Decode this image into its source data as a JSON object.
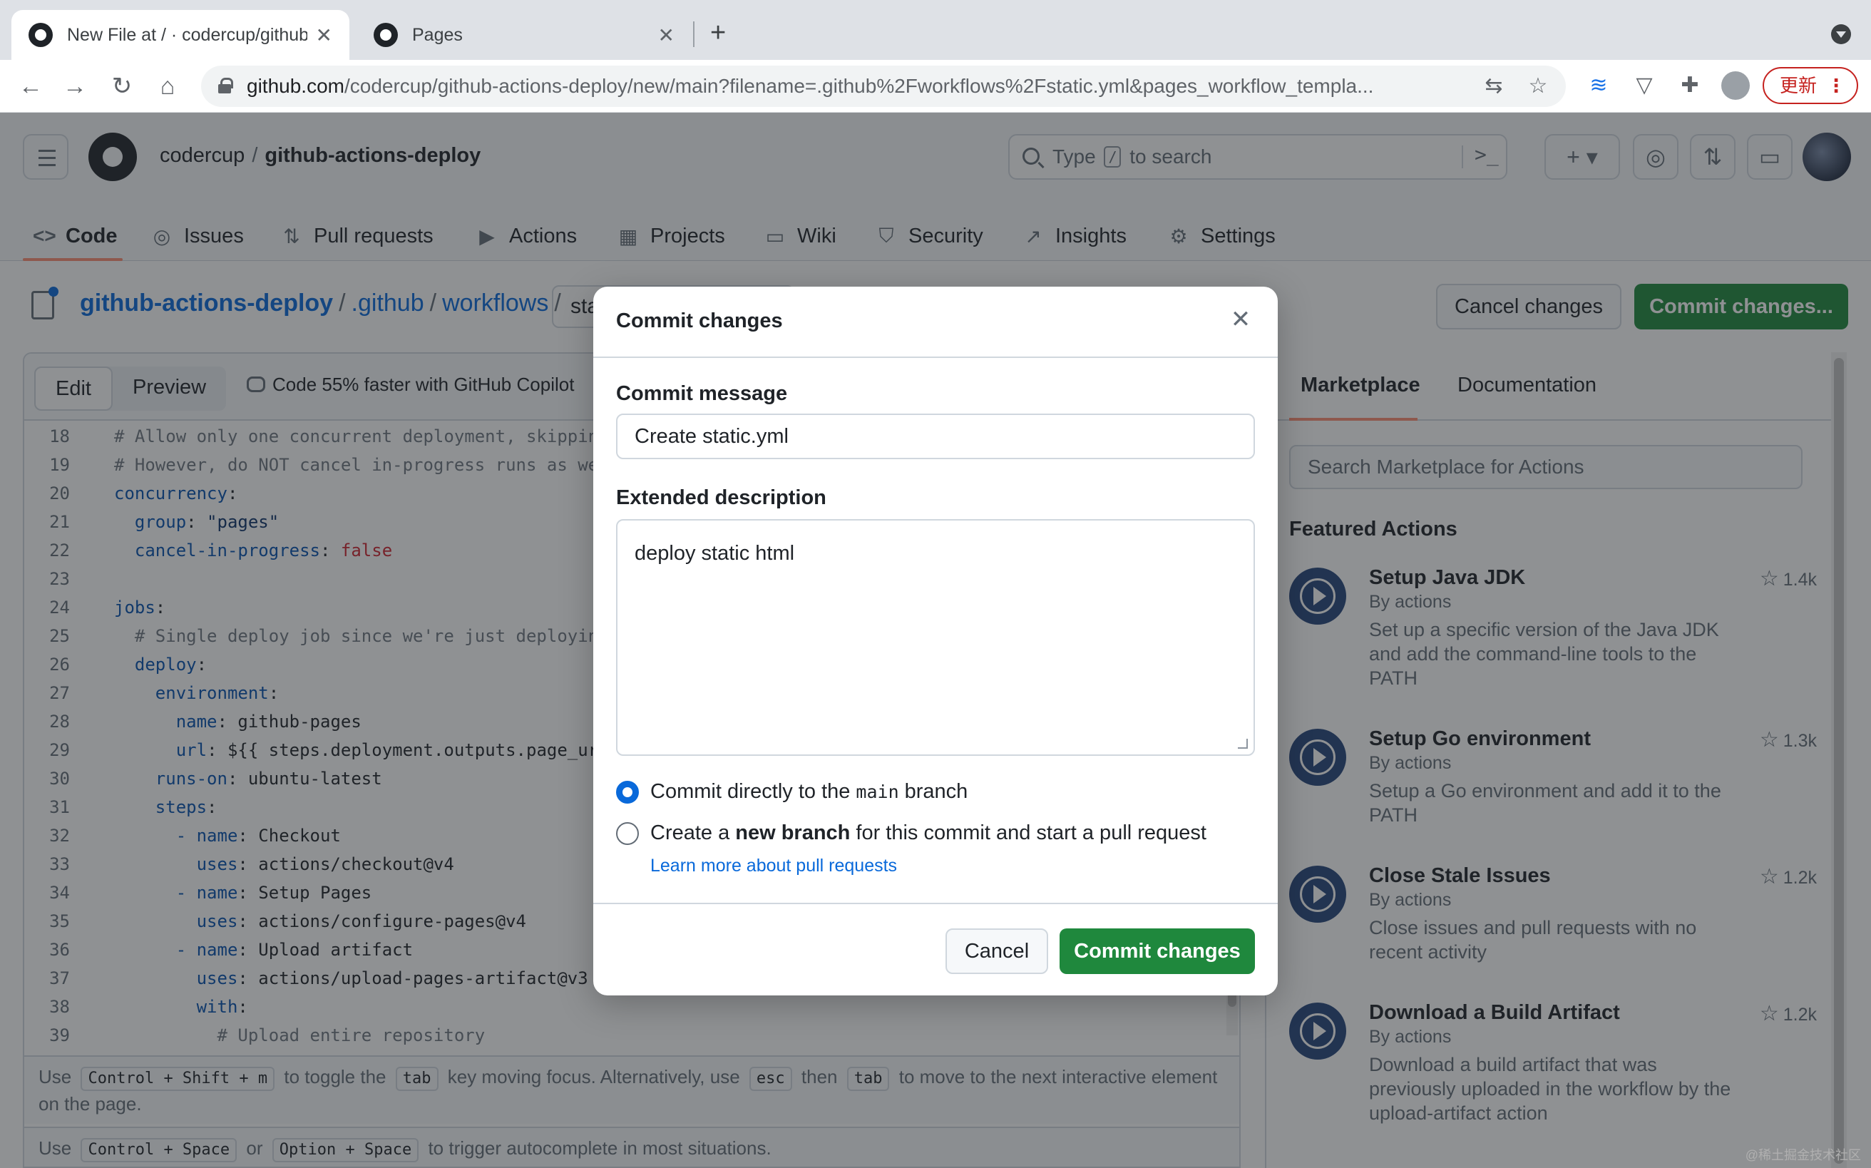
{
  "browser": {
    "tabs": [
      {
        "title": "New File at / · codercup/github-actions-deploy",
        "close": "✕"
      },
      {
        "title": "Pages",
        "close": "✕"
      }
    ],
    "new_tab": "+",
    "url_host": "github.com",
    "url_path": "/codercup/github-actions-deploy/new/main?filename=.github%2Fworkflows%2Fstatic.yml&pages_workflow_templa...",
    "update_label": "更新",
    "update_dots": "⋮"
  },
  "header": {
    "owner": "codercup",
    "separator": "/",
    "repo": "github-actions-deploy",
    "search_prefix": "Type",
    "search_key": "/",
    "search_suffix": "to search",
    "nav": [
      {
        "label": "Code",
        "icon": "<>"
      },
      {
        "label": "Issues",
        "icon": "◎"
      },
      {
        "label": "Pull requests",
        "icon": "⇅"
      },
      {
        "label": "Actions",
        "icon": "▶"
      },
      {
        "label": "Projects",
        "icon": "▦"
      },
      {
        "label": "Wiki",
        "icon": "▭"
      },
      {
        "label": "Security",
        "icon": "⛉"
      },
      {
        "label": "Insights",
        "icon": "↗"
      },
      {
        "label": "Settings",
        "icon": "⚙"
      }
    ]
  },
  "editor_page": {
    "crumbs": [
      "github-actions-deploy",
      "/",
      ".github",
      "/",
      "workflows",
      "/"
    ],
    "filename": "static.yml",
    "cancel_changes": "Cancel changes",
    "commit_changes": "Commit changes...",
    "tab_edit": "Edit",
    "tab_preview": "Preview",
    "copilot": "Code 55% faster with GitHub Copilot",
    "code_lines": [
      {
        "n": "18",
        "text": "# Allow only one concurrent deployment, skippin"
      },
      {
        "n": "19",
        "text": "# However, do NOT cancel in-progress runs as we"
      },
      {
        "n": "20",
        "text": "concurrency:"
      },
      {
        "n": "21",
        "text": "  group: \"pages\""
      },
      {
        "n": "22",
        "text": "  cancel-in-progress: false"
      },
      {
        "n": "23",
        "text": ""
      },
      {
        "n": "24",
        "text": "jobs:"
      },
      {
        "n": "25",
        "text": "  # Single deploy job since we're just deployin"
      },
      {
        "n": "26",
        "text": "  deploy:"
      },
      {
        "n": "27",
        "text": "    environment:"
      },
      {
        "n": "28",
        "text": "      name: github-pages"
      },
      {
        "n": "29",
        "text": "      url: ${{ steps.deployment.outputs.page_ur"
      },
      {
        "n": "30",
        "text": "    runs-on: ubuntu-latest"
      },
      {
        "n": "31",
        "text": "    steps:"
      },
      {
        "n": "32",
        "text": "      - name: Checkout"
      },
      {
        "n": "33",
        "text": "        uses: actions/checkout@v4"
      },
      {
        "n": "34",
        "text": "      - name: Setup Pages"
      },
      {
        "n": "35",
        "text": "        uses: actions/configure-pages@v4"
      },
      {
        "n": "36",
        "text": "      - name: Upload artifact"
      },
      {
        "n": "37",
        "text": "        uses: actions/upload-pages-artifact@v3"
      },
      {
        "n": "38",
        "text": "        with:"
      },
      {
        "n": "39",
        "text": "          # Upload entire repository"
      }
    ],
    "hint1": {
      "use": "Use",
      "k1": "Control + Shift + m",
      "t1": "to toggle the",
      "k2": "tab",
      "t2": "key moving focus. Alternatively, use",
      "k3": "esc",
      "t3": "then",
      "k4": "tab",
      "t4": "to move to the next interactive element on the page."
    },
    "hint2": {
      "use": "Use",
      "k1": "Control + Space",
      "t1": "or",
      "k2": "Option + Space",
      "t2": "to trigger autocomplete in most situations."
    }
  },
  "sidebar": {
    "tab_marketplace": "Marketplace",
    "tab_docs": "Documentation",
    "search_placeholder": "Search Marketplace for Actions",
    "featured": "Featured Actions",
    "actions": [
      {
        "name": "Setup Java JDK",
        "by": "By actions",
        "desc": "Set up a specific version of the Java JDK and add the command-line tools to the PATH",
        "stars": "1.4k"
      },
      {
        "name": "Setup Go environment",
        "by": "By actions",
        "desc": "Setup a Go environment and add it to the PATH",
        "stars": "1.3k"
      },
      {
        "name": "Close Stale Issues",
        "by": "By actions",
        "desc": "Close issues and pull requests with no recent activity",
        "stars": "1.2k"
      },
      {
        "name": "Download a Build Artifact",
        "by": "By actions",
        "desc": "Download a build artifact that was previously uploaded in the workflow by the upload-artifact action",
        "stars": "1.2k"
      }
    ]
  },
  "modal": {
    "title": "Commit changes",
    "close": "✕",
    "message_label": "Commit message",
    "message_value": "Create static.yml",
    "desc_label": "Extended description",
    "desc_value": "deploy static html",
    "opt1_before": "Commit directly to the",
    "opt1_code": "main",
    "opt1_after": "branch",
    "opt2_before": "Create a",
    "opt2_bold": "new branch",
    "opt2_after": "for this commit and start a pull request",
    "learn_more": "Learn more about pull requests",
    "cancel": "Cancel",
    "commit": "Commit changes",
    "selected_option": 1
  },
  "watermark": "@稀土掘金技术社区",
  "colors": {
    "primary_green": "#1f883d",
    "link_blue": "#0969da",
    "accent_orange": "#fd8c73"
  }
}
